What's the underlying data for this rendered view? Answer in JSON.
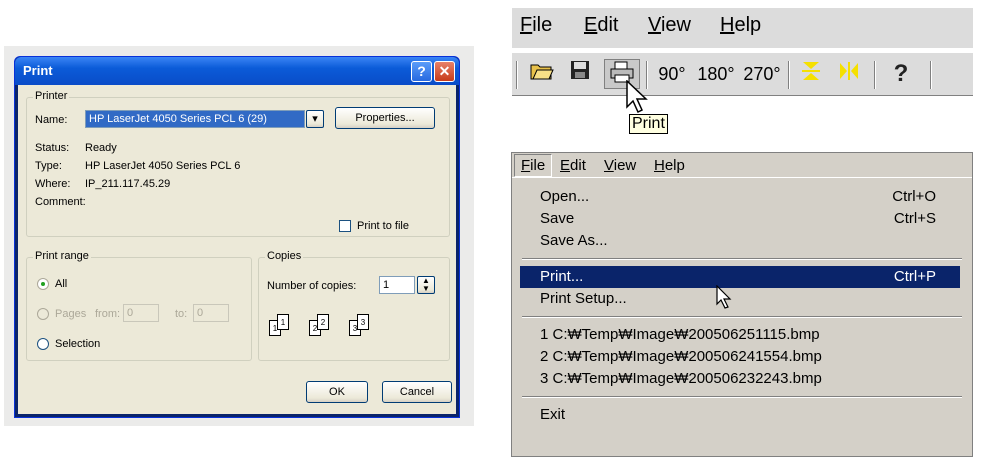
{
  "print_dialog": {
    "title": "Print",
    "help_label": "?",
    "close_label": "✕",
    "printer_group": "Printer",
    "name_label": "Name:",
    "name_value": "HP LaserJet 4050 Series PCL 6 (29)",
    "properties_label": "Properties...",
    "status_label": "Status:",
    "status_value": "Ready",
    "type_label": "Type:",
    "type_value": "HP LaserJet 4050 Series PCL 6",
    "where_label": "Where:",
    "where_value": "IP_211.117.45.29",
    "comment_label": "Comment:",
    "print_to_file_label": "Print to file",
    "print_range_group": "Print range",
    "all_label": "All",
    "pages_label": "Pages",
    "from_label": "from:",
    "from_value": "0",
    "to_label": "to:",
    "to_value": "0",
    "selection_label": "Selection",
    "copies_group": "Copies",
    "copies_label": "Number of copies:",
    "copies_value": "1",
    "ok_label": "OK",
    "cancel_label": "Cancel"
  },
  "toolbar_shot": {
    "menus": [
      {
        "label": "File",
        "u": "F",
        "rest": "ile"
      },
      {
        "label": "Edit",
        "u": "E",
        "rest": "dit"
      },
      {
        "label": "View",
        "u": "V",
        "rest": "iew"
      },
      {
        "label": "Help",
        "u": "H",
        "rest": "elp"
      }
    ],
    "rotate_90": "90°",
    "rotate_180": "180°",
    "rotate_270": "270°",
    "tooltip": "Print"
  },
  "menu_shot": {
    "menus": [
      {
        "label": "File",
        "u": "F",
        "rest": "ile"
      },
      {
        "label": "Edit",
        "u": "E",
        "rest": "dit"
      },
      {
        "label": "View",
        "u": "V",
        "rest": "iew"
      },
      {
        "label": "Help",
        "u": "H",
        "rest": "elp"
      }
    ],
    "items": {
      "open": {
        "label": "Open...",
        "shortcut": "Ctrl+O"
      },
      "save": {
        "label": "Save",
        "shortcut": "Ctrl+S"
      },
      "save_as": {
        "label": "Save As..."
      },
      "print": {
        "label": "Print...",
        "shortcut": "Ctrl+P"
      },
      "print_setup": {
        "label": "Print Setup..."
      },
      "recent1": {
        "label": "1 C:₩Temp₩Image₩200506251115.bmp"
      },
      "recent2": {
        "label": "2 C:₩Temp₩Image₩200506241554.bmp"
      },
      "recent3": {
        "label": "3 C:₩Temp₩Image₩200506232243.bmp"
      },
      "exit": {
        "label": "Exit"
      }
    }
  }
}
